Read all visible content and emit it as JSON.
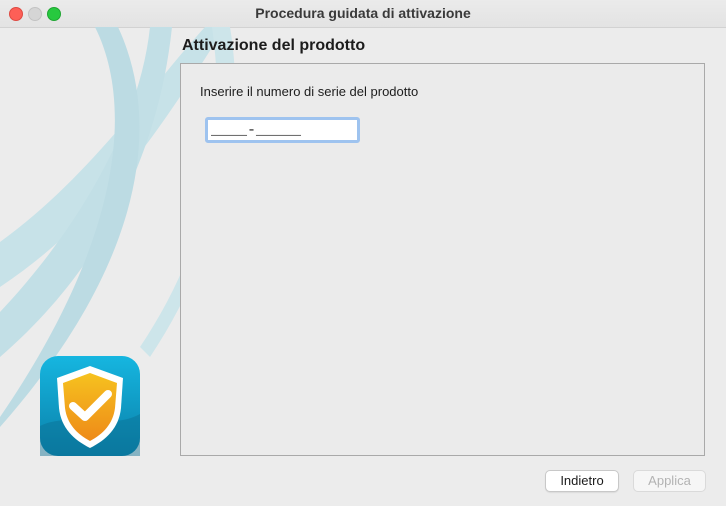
{
  "window": {
    "title": "Procedura guidata di attivazione"
  },
  "main": {
    "section_title": "Attivazione del prodotto",
    "prompt": "Inserire il numero di serie del prodotto",
    "serial_field": {
      "value": "____-_____"
    }
  },
  "buttons": {
    "back_label": "Indietro",
    "apply_label": "Applica",
    "apply_enabled": false
  },
  "icons": {
    "app_icon": "shield-check-icon"
  },
  "colors": {
    "decor_swirl": "#bfdde4",
    "icon_tile": "#1aa6cf",
    "shield": "#f2a61e",
    "focus_ring": "#9ec3ef"
  }
}
